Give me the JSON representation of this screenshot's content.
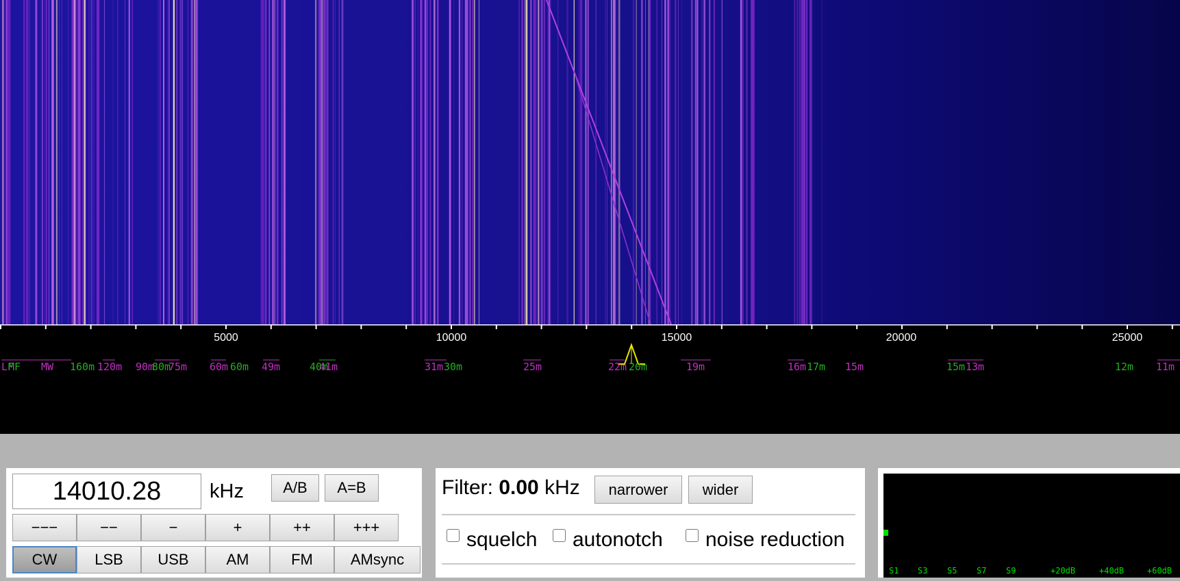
{
  "waterfall": {
    "colors": {
      "background": "#0b0a6a",
      "signal": "#9b30e0",
      "strong": "#ffe4b4"
    }
  },
  "scale": {
    "ticks": [
      "5000",
      "10000",
      "15000",
      "20000",
      "25000"
    ],
    "bands_magenta": [
      "LF",
      "MW",
      "160m",
      "90m",
      "75m",
      "60m",
      "49m",
      "41m",
      "31m",
      "25m",
      "22m",
      "19m",
      "16m",
      "15m",
      "13m",
      "11m"
    ],
    "bands_green": [
      "MF",
      "120m",
      "80m",
      "60m",
      "40m",
      "30m",
      "20m",
      "17m",
      "15m",
      "12m"
    ],
    "colors": {
      "magenta": "#c030c0",
      "green": "#20b020",
      "marker": "#e8e800"
    }
  },
  "freq": {
    "value": "14010.28",
    "unit": "kHz",
    "ab_label": "A/B",
    "aeqb_label": "A=B",
    "steps": [
      "−−−",
      "−−",
      "−",
      "+",
      "++",
      "+++"
    ],
    "modes": [
      "CW",
      "LSB",
      "USB",
      "AM",
      "FM",
      "AMsync"
    ],
    "selected_mode": "CW"
  },
  "filter": {
    "label": "Filter:",
    "value": "0.00",
    "unit": "kHz",
    "narrower": "narrower",
    "wider": "wider",
    "squelch": "squelch",
    "autonotch": "autonotch",
    "noise_reduction": "noise reduction"
  },
  "smeter": {
    "labels": [
      "S1",
      "S3",
      "S5",
      "S7",
      "S9",
      "+20dB",
      "+40dB",
      "+60dB"
    ],
    "level": 0.0,
    "color": "#00e000"
  }
}
